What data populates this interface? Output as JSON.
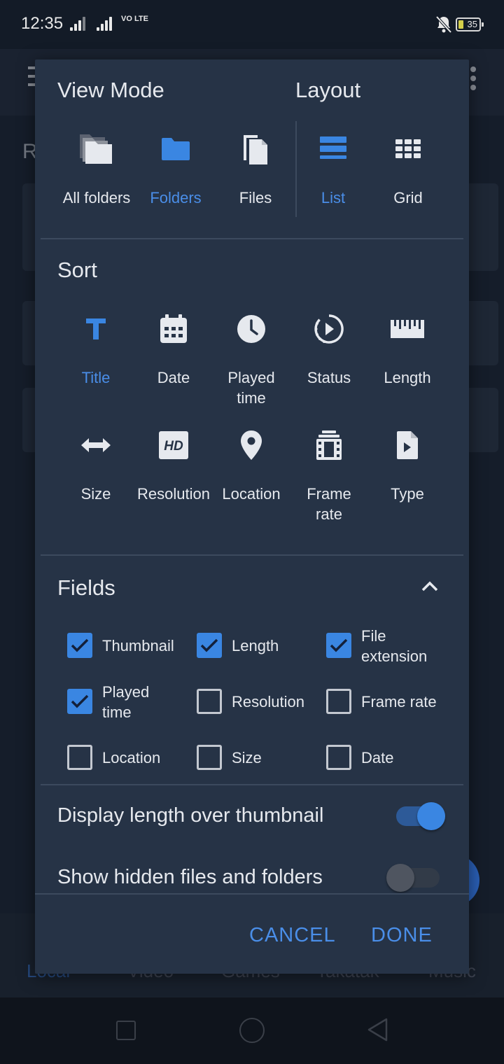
{
  "status_bar": {
    "time": "12:35",
    "network": "VO LTE",
    "battery": "35"
  },
  "background_app": {
    "partial_heading": "R",
    "bottom_tabs": [
      "Local",
      "Video",
      "Games",
      "Takatak",
      "Music"
    ]
  },
  "dialog": {
    "view_mode": {
      "title": "View Mode",
      "options": [
        {
          "label": "All folders",
          "icon": "stacked-folders-icon",
          "selected": false
        },
        {
          "label": "Folders",
          "icon": "folder-icon",
          "selected": true
        },
        {
          "label": "Files",
          "icon": "files-icon",
          "selected": false
        }
      ]
    },
    "layout": {
      "title": "Layout",
      "options": [
        {
          "label": "List",
          "icon": "list-icon",
          "selected": true
        },
        {
          "label": "Grid",
          "icon": "grid-icon",
          "selected": false
        }
      ]
    },
    "sort": {
      "title": "Sort",
      "options": [
        {
          "label": "Title",
          "icon": "title-t-icon",
          "selected": true
        },
        {
          "label": "Date",
          "icon": "calendar-icon",
          "selected": false
        },
        {
          "label": "Played\ntime",
          "icon": "clock-icon",
          "selected": false
        },
        {
          "label": "Status",
          "icon": "play-status-icon",
          "selected": false
        },
        {
          "label": "Length",
          "icon": "ruler-icon",
          "selected": false
        },
        {
          "label": "Size",
          "icon": "resize-arrows-icon",
          "selected": false
        },
        {
          "label": "Resolution",
          "icon": "hd-icon",
          "selected": false
        },
        {
          "label": "Location",
          "icon": "location-pin-icon",
          "selected": false
        },
        {
          "label": "Frame\nrate",
          "icon": "film-frame-icon",
          "selected": false
        },
        {
          "label": "Type",
          "icon": "file-type-icon",
          "selected": false
        }
      ]
    },
    "fields": {
      "title": "Fields",
      "items": [
        {
          "label": "Thumbnail",
          "checked": true
        },
        {
          "label": "Length",
          "checked": true
        },
        {
          "label": "File\nextension",
          "checked": true
        },
        {
          "label": "Played\ntime",
          "checked": true
        },
        {
          "label": "Resolution",
          "checked": false
        },
        {
          "label": "Frame rate",
          "checked": false
        },
        {
          "label": "Location",
          "checked": false
        },
        {
          "label": "Size",
          "checked": false
        },
        {
          "label": "Date",
          "checked": false
        }
      ]
    },
    "toggles": [
      {
        "label": "Display length over thumbnail",
        "on": true
      },
      {
        "label": "Show hidden files and folders",
        "on": false
      }
    ],
    "buttons": {
      "cancel": "CANCEL",
      "done": "DONE"
    }
  },
  "colors": {
    "accent": "#4a8ee8",
    "dialog_bg": "#263346",
    "text": "#e6e9ee"
  }
}
